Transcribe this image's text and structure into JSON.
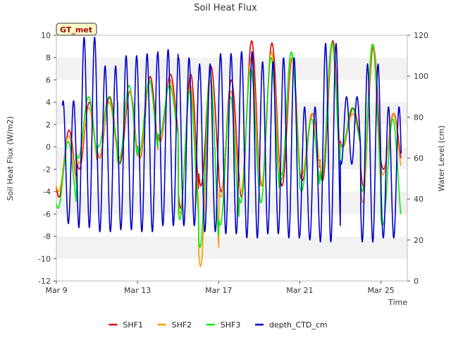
{
  "chart_data": {
    "type": "line",
    "title": "Soil Heat Flux",
    "xlabel": "Time",
    "ylabel": "Soil Heat Flux (W/m2)",
    "y2label": "Water Level (cm)",
    "badge": "GT_met",
    "xlim": [
      0,
      17.3
    ],
    "ylim": [
      -12,
      10
    ],
    "y2lim": [
      0,
      120
    ],
    "x_ticks": [
      {
        "pos": 0,
        "label": "Mar 9"
      },
      {
        "pos": 4,
        "label": "Mar 13"
      },
      {
        "pos": 8,
        "label": "Mar 17"
      },
      {
        "pos": 12,
        "label": "Mar 21"
      },
      {
        "pos": 16,
        "label": "Mar 25"
      }
    ],
    "y_ticks": [
      -12,
      -10,
      -8,
      -6,
      -4,
      -2,
      0,
      2,
      4,
      6,
      8,
      10
    ],
    "y2_ticks": [
      0,
      20,
      40,
      60,
      80,
      100,
      120
    ],
    "legend_position": "bottom",
    "colors": {
      "SHF1": "#dd0000",
      "SHF2": "#ff9900",
      "SHF3": "#00ee00",
      "depth_CTD_cm": "#0000cc"
    },
    "series_meta": [
      {
        "name": "SHF1",
        "axis": "left"
      },
      {
        "name": "SHF2",
        "axis": "left"
      },
      {
        "name": "SHF3",
        "axis": "left"
      },
      {
        "name": "depth_CTD_cm",
        "axis": "right"
      }
    ],
    "daily": [
      {
        "day": 0,
        "SHF1": [
          -4.5,
          1.5
        ],
        "SHF2": [
          -4.0,
          1.0
        ],
        "SHF3": [
          -5.5,
          0.5
        ],
        "depth": [
          28,
          88
        ]
      },
      {
        "day": 1,
        "SHF1": [
          -2.0,
          4.0
        ],
        "SHF2": [
          -1.5,
          3.5
        ],
        "SHF3": [
          -1.0,
          4.5
        ],
        "depth": [
          26,
          119
        ]
      },
      {
        "day": 2,
        "SHF1": [
          -1.0,
          4.5
        ],
        "SHF2": [
          -1.0,
          4.0
        ],
        "SHF3": [
          0.0,
          4.5
        ],
        "depth": [
          24,
          105
        ]
      },
      {
        "day": 3,
        "SHF1": [
          -1.5,
          5.0
        ],
        "SHF2": [
          -1.0,
          5.0
        ],
        "SHF3": [
          -1.5,
          5.5
        ],
        "depth": [
          25,
          110
        ]
      },
      {
        "day": 4,
        "SHF1": [
          -1.0,
          6.3
        ],
        "SHF2": [
          -1.0,
          5.8
        ],
        "SHF3": [
          -0.5,
          6.0
        ],
        "depth": [
          24,
          111
        ]
      },
      {
        "day": 5,
        "SHF1": [
          0.5,
          6.5
        ],
        "SHF2": [
          0.5,
          6.0
        ],
        "SHF3": [
          1.0,
          5.5
        ],
        "depth": [
          27,
          113
        ]
      },
      {
        "day": 6,
        "SHF1": [
          -5.5,
          6.5
        ],
        "SHF2": [
          -6.0,
          5.5
        ],
        "SHF3": [
          -6.5,
          5.0
        ],
        "depth": [
          27,
          109
        ]
      },
      {
        "day": 7,
        "SHF1": [
          -3.5,
          7.2
        ],
        "SHF2": [
          -10.7,
          6.0
        ],
        "SHF3": [
          -9.0,
          6.5
        ],
        "depth": [
          24,
          106
        ]
      },
      {
        "day": 8,
        "SHF1": [
          -4.0,
          6.0
        ],
        "SHF2": [
          -4.5,
          5.0
        ],
        "SHF3": [
          -7.0,
          4.5
        ],
        "depth": [
          23,
          111
        ]
      },
      {
        "day": 9,
        "SHF1": [
          -4.5,
          9.5
        ],
        "SHF2": [
          -4.0,
          8.0
        ],
        "SHF3": [
          -5.0,
          7.0
        ],
        "depth": [
          21,
          112
        ]
      },
      {
        "day": 10,
        "SHF1": [
          -3.5,
          9.3
        ],
        "SHF2": [
          -3.5,
          8.5
        ],
        "SHF3": [
          -5.0,
          8.0
        ],
        "depth": [
          23,
          107
        ]
      },
      {
        "day": 11,
        "SHF1": [
          -3.5,
          8.0
        ],
        "SHF2": [
          -2.5,
          8.0
        ],
        "SHF3": [
          -3.0,
          8.5
        ],
        "depth": [
          21,
          109
        ]
      },
      {
        "day": 12,
        "SHF1": [
          -3.0,
          3.0
        ],
        "SHF2": [
          -2.5,
          3.0
        ],
        "SHF3": [
          -4.0,
          2.5
        ],
        "depth": [
          20,
          85
        ]
      },
      {
        "day": 13,
        "SHF1": [
          -3.0,
          9.5
        ],
        "SHF2": [
          -2.5,
          9.3
        ],
        "SHF3": [
          -3.0,
          9.3
        ],
        "depth": [
          19,
          116
        ]
      },
      {
        "day": 14,
        "SHF1": [
          0.0,
          3.5
        ],
        "SHF2": [
          0.0,
          3.0
        ],
        "SHF3": [
          0.0,
          3.5
        ],
        "depth": [
          57,
          90
        ]
      },
      {
        "day": 15,
        "SHF1": [
          -3.5,
          9.0
        ],
        "SHF2": [
          -5.0,
          9.2
        ],
        "SHF3": [
          -4.0,
          9.2
        ],
        "depth": [
          19,
          106
        ]
      },
      {
        "day": 16,
        "SHF1": [
          -2.0,
          3.0
        ],
        "SHF2": [
          -2.5,
          3.0
        ],
        "SHF3": [
          -7.0,
          2.5
        ],
        "depth": [
          21,
          85
        ]
      },
      {
        "day": 17,
        "SHF1": [
          -2.5,
          7.5
        ],
        "SHF2": [
          -3.0,
          7.5
        ],
        "SHF3": [
          -4.5,
          7.0
        ],
        "depth": [
          19,
          95
        ]
      },
      {
        "day": 18,
        "SHF1": [
          -3.5,
          3.5
        ],
        "SHF2": [
          -3.0,
          3.5
        ],
        "SHF3": [
          -4.0,
          3.0
        ],
        "depth": [
          20,
          85
        ]
      },
      {
        "day": 19,
        "SHF1": [
          -7.5,
          8.0
        ],
        "SHF2": [
          -6.0,
          8.0
        ],
        "SHF3": [
          -6.0,
          8.2
        ],
        "depth": [
          19,
          106
        ]
      },
      {
        "day": 20,
        "SHF1": [
          -4.5,
          6.0
        ],
        "SHF2": [
          -4.0,
          6.0
        ],
        "SHF3": [
          -5.0,
          6.5
        ],
        "depth": [
          23,
          101
        ]
      },
      {
        "day": 21,
        "SHF1": [
          -4.0,
          5.5
        ],
        "SHF2": [
          -4.0,
          5.5
        ],
        "SHF3": [
          -5.0,
          5.0
        ],
        "depth": [
          23,
          105
        ]
      },
      {
        "day": 22,
        "SHF1": [
          -3.0,
          6.5
        ],
        "SHF2": [
          -3.5,
          5.5
        ],
        "SHF3": [
          -5.5,
          6.0
        ],
        "depth": [
          22,
          102
        ]
      },
      {
        "day": 23,
        "SHF1": [
          -2.5,
          6.5
        ],
        "SHF2": [
          -3.0,
          6.0
        ],
        "SHF3": [
          -4.0,
          6.0
        ],
        "depth": [
          22,
          104
        ]
      },
      {
        "day": 24,
        "SHF1": [
          -2.5,
          7.3
        ],
        "SHF2": [
          -5.0,
          6.3
        ],
        "SHF3": [
          -5.0,
          6.0
        ],
        "depth": [
          23,
          93
        ]
      },
      {
        "day": 25,
        "SHF1": [
          -3.5,
          5.0
        ],
        "SHF2": [
          -2.0,
          5.5
        ],
        "SHF3": [
          -2.0,
          5.5
        ],
        "depth": [
          24,
          88
        ]
      }
    ]
  },
  "legend": [
    {
      "label": "SHF1",
      "color": "#dd0000"
    },
    {
      "label": "SHF2",
      "color": "#ff9900"
    },
    {
      "label": "SHF3",
      "color": "#00ee00"
    },
    {
      "label": "depth_CTD_cm",
      "color": "#0000cc"
    }
  ]
}
